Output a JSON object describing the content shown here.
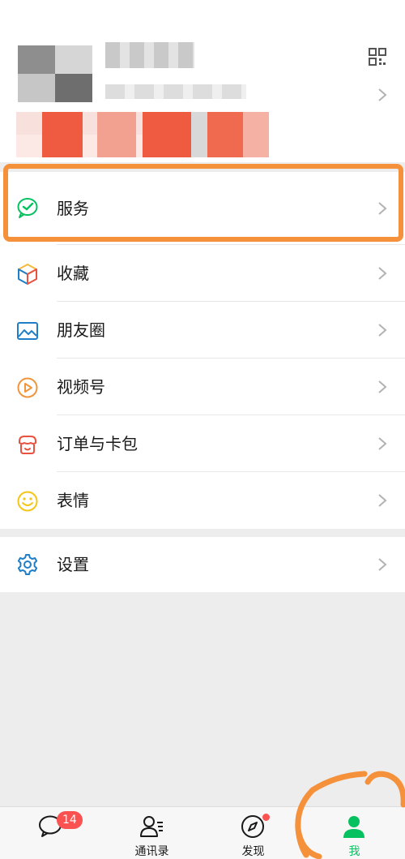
{
  "profile": {
    "name": "",
    "wechat_id": ""
  },
  "menu": {
    "group1": [
      {
        "label": "服务",
        "icon": "wechat-pay-icon",
        "color": "#07c160"
      },
      {
        "label": "收藏",
        "icon": "favorites-cube-icon",
        "color": "#f6b93b"
      },
      {
        "label": "朋友圈",
        "icon": "moments-picture-icon",
        "color": "#1e7ec8"
      },
      {
        "label": "视频号",
        "icon": "video-channels-icon",
        "color": "#f0953c"
      },
      {
        "label": "订单与卡包",
        "icon": "orders-cards-icon",
        "color": "#e8523f"
      },
      {
        "label": "表情",
        "icon": "sticker-smiley-icon",
        "color": "#f5c518"
      }
    ],
    "group2": [
      {
        "label": "设置",
        "icon": "settings-gear-icon",
        "color": "#1e7ec8"
      }
    ]
  },
  "tabbar": [
    {
      "label": "",
      "icon": "chats-bubble-icon",
      "badge": "14"
    },
    {
      "label": "通讯录",
      "icon": "contacts-icon"
    },
    {
      "label": "发现",
      "icon": "discover-compass-icon",
      "dot": true
    },
    {
      "label": "我",
      "icon": "me-person-icon",
      "active": true
    }
  ],
  "colors": {
    "accent": "#07c160",
    "badge": "#fa5151",
    "annotation": "#f4913a"
  }
}
